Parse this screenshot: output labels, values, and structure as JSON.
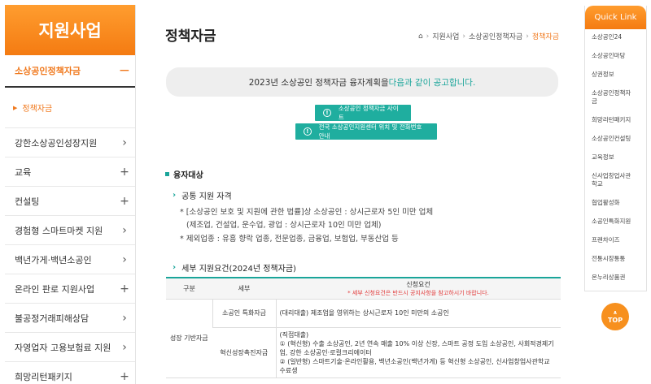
{
  "sidebar": {
    "title": "지원사업",
    "active": {
      "label": "소상공인정책자금",
      "indicator": "−"
    },
    "sub_item": "정책자금",
    "items": [
      {
        "label": "강한소상공인성장지원",
        "indicator": "›"
      },
      {
        "label": "교육",
        "indicator": "+"
      },
      {
        "label": "컨설팅",
        "indicator": "+"
      },
      {
        "label": "경험형 스마트마켓 지원",
        "indicator": "›"
      },
      {
        "label": "백년가게·백년소공인",
        "indicator": "›"
      },
      {
        "label": "온라인 판로 지원사업",
        "indicator": "+"
      },
      {
        "label": "불공정거래피해상담",
        "indicator": "›"
      },
      {
        "label": "자영업자 고용보험료 지원",
        "indicator": "›"
      },
      {
        "label": "희망리턴패키지",
        "indicator": "+"
      }
    ]
  },
  "main": {
    "title": "정책자금",
    "breadcrumb": [
      "지원사업",
      "소상공인정책자금",
      "정책자금"
    ],
    "notice_prefix": "2023년 소상공인 정책자금 융자계획을 ",
    "notice_highlight": "다음과 같이 공고합니다.",
    "btn_site": "소상공인 정책자금 사이트",
    "btn_center": "전국 소상공인지원센터 위치 및 전화번호 안내",
    "section_title": "융자대상",
    "common_title": "공통 지원 자격",
    "common_line1": "* [소상공인 보호 및 지원에 관한 법률]상 소상공인 : 상시근로자 5인 미만 업체",
    "common_line2": "(제조업, 건설업, 운수업, 광업 : 상시근로자 10인 미만 업체)",
    "common_line3": "* 제외업종 : 유흥 향락 업종, 전문업종, 금융업, 보험업, 부동산업 등",
    "detail_title": "세부 지원요건(2024년 정책자금)",
    "table": {
      "headers": [
        "구분",
        "세부",
        "신청요건"
      ],
      "header_note": "* 세부 신청요건은 반드시 공지사항을 참고하시기 바랍니다.",
      "group": "성장 기반자금",
      "rows": [
        {
          "sub": "소공인 특화자금",
          "req": "(대리대출) 제조업을 영위하는 상시근로자 10인 미만의 소공인"
        },
        {
          "sub": "혁신성장촉진자금",
          "req_title": "(직접대출)",
          "req1": "① (혁신형) 수출 소상공인, 2년 연속 매출 10% 이상 신장, 스마트 공정 도입 소상공인, 사회적경제기업, 강한 소상공인·로컬크리에이터",
          "req2": "② (일반형) 스마트기술·온라인활용, 백년소공인(백년가게) 등 혁신형 소상공인, 신사업창업사관학교 수료생"
        }
      ]
    }
  },
  "quick": {
    "title": "Quick Link",
    "links": [
      "소상공인24",
      "소상공인마당",
      "상권정보",
      "소상공인정책자금",
      "희망리턴패키지",
      "소상공인컨설팅",
      "교육정보",
      "신사업창업사관학교",
      "협업활성화",
      "소공인특화지원",
      "프랜차이즈",
      "전통시장통통",
      "온누리상품권"
    ]
  },
  "top_label": "TOP"
}
